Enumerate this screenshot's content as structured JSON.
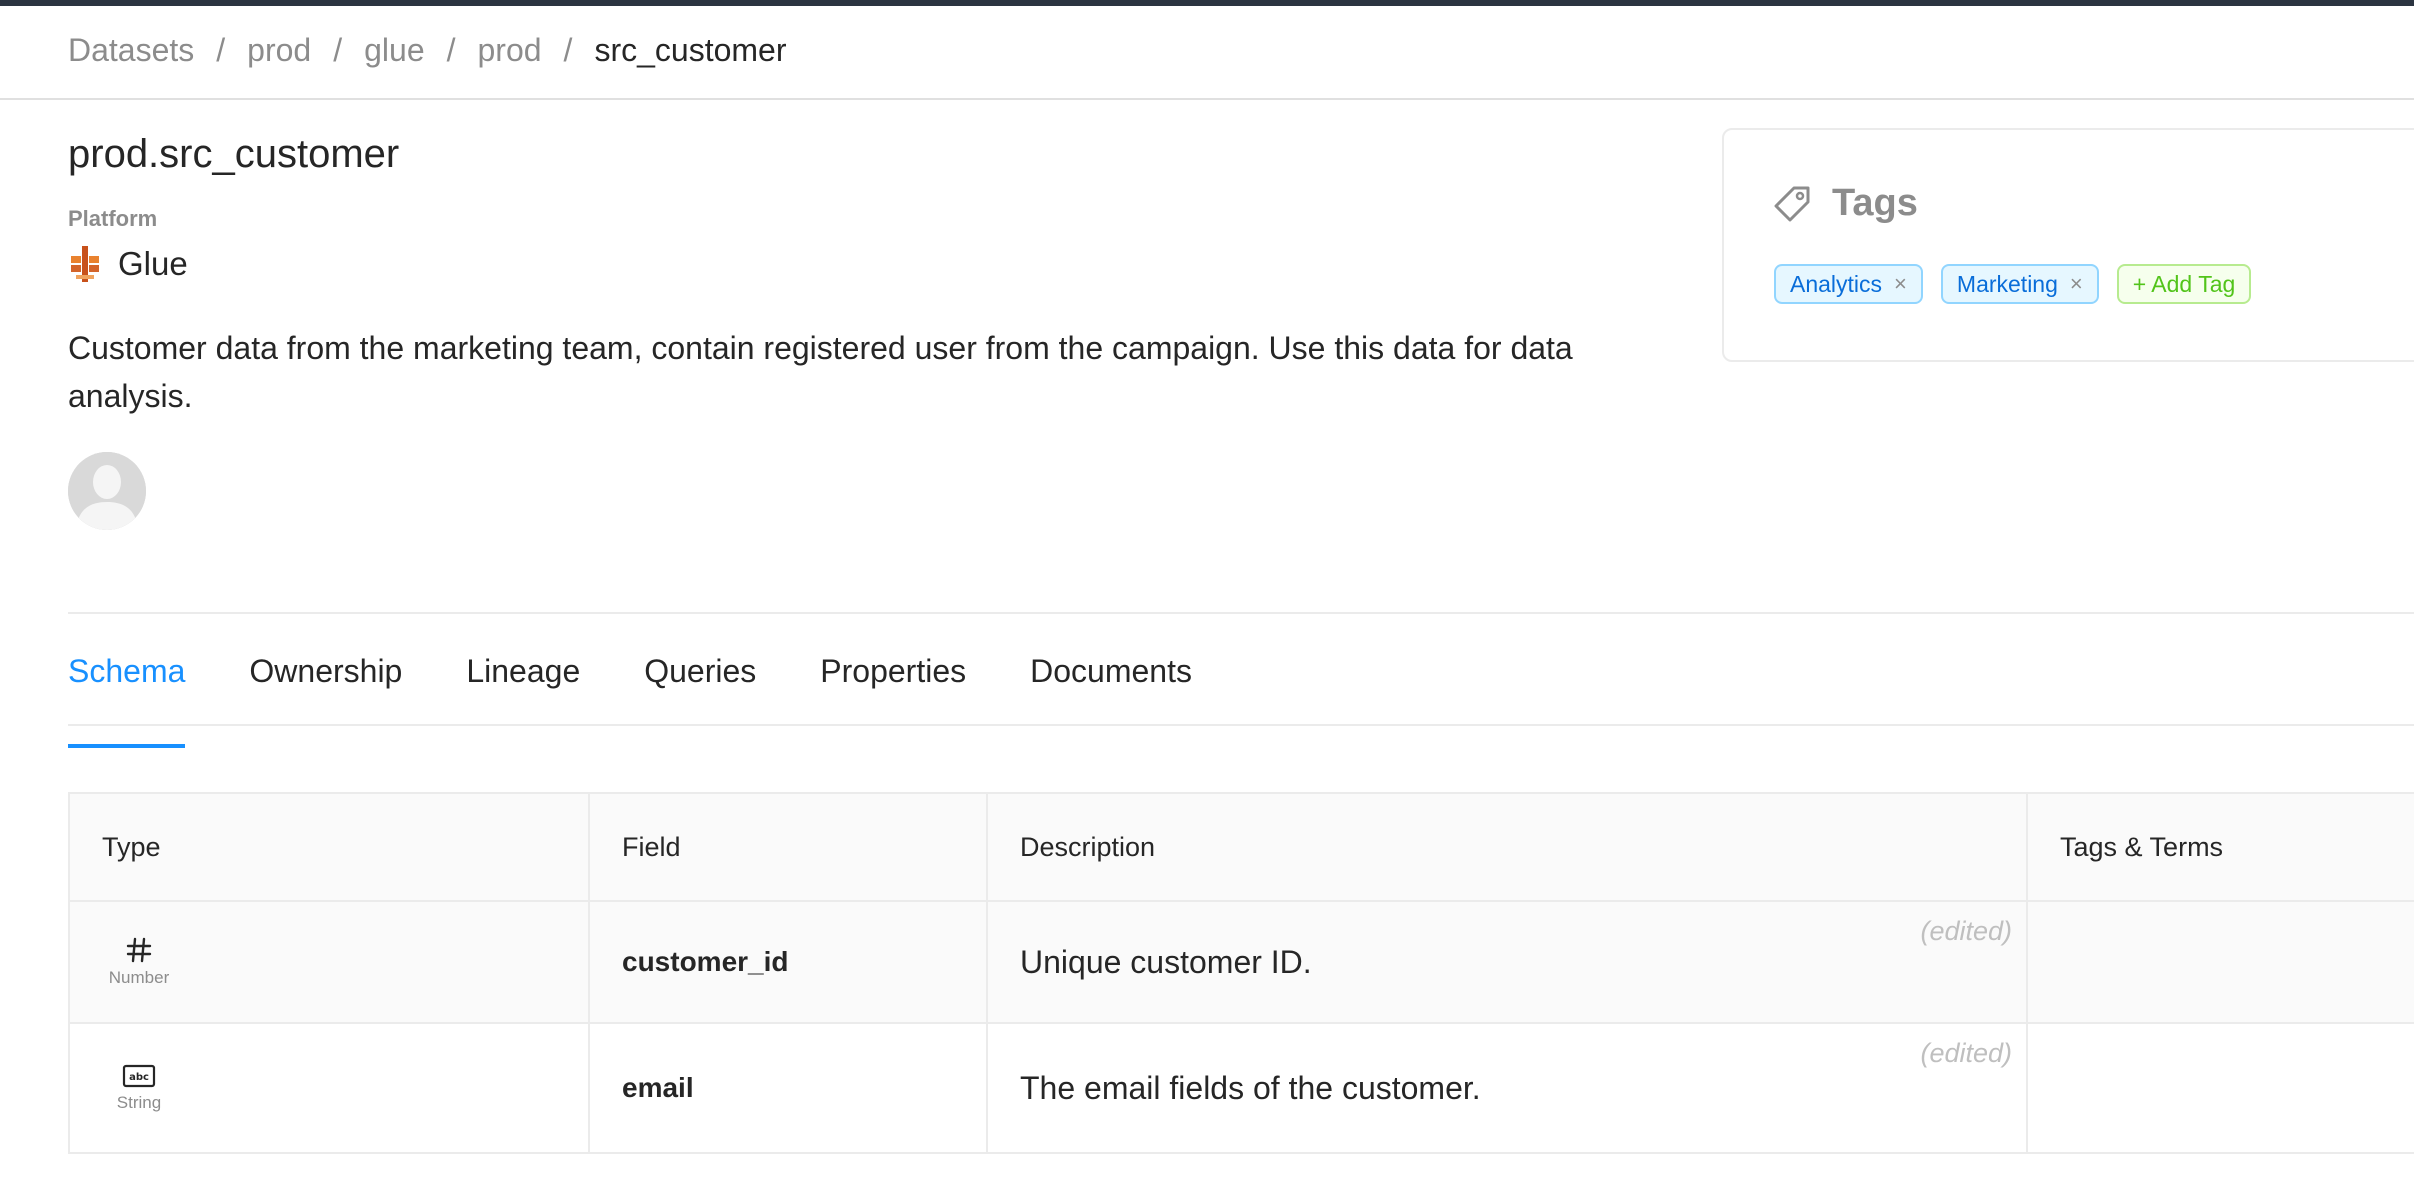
{
  "breadcrumb": {
    "items": [
      "Datasets",
      "prod",
      "glue",
      "prod"
    ],
    "separator": "/",
    "current": "src_customer"
  },
  "dataset": {
    "title": "prod.src_customer",
    "platform_label": "Platform",
    "platform_name": "Glue",
    "description": "Customer data from the marketing team, contain registered user from the campaign. Use this data for data analysis."
  },
  "tags_panel": {
    "title": "Tags",
    "tags": [
      "Analytics",
      "Marketing"
    ],
    "add_label": "+ Add Tag",
    "remove_glyph": "×"
  },
  "tabs": [
    "Schema",
    "Ownership",
    "Lineage",
    "Queries",
    "Properties",
    "Documents"
  ],
  "active_tab": "Schema",
  "schema": {
    "columns": [
      "Type",
      "Field",
      "Description",
      "Tags & Terms"
    ],
    "rows": [
      {
        "type_icon": "hash-icon",
        "type_glyph": "#",
        "type_label": "Number",
        "field": "customer_id",
        "description": "Unique customer ID.",
        "edited": "(edited)"
      },
      {
        "type_icon": "abc-string-icon",
        "type_glyph": "abc",
        "type_label": "String",
        "field": "email",
        "description": "The email fields of the customer.",
        "edited": "(edited)"
      }
    ]
  },
  "colors": {
    "accent": "#1890ff",
    "topbar": "#2b3441",
    "tag_blue_text": "#096dd9",
    "tag_green_text": "#52c41a"
  }
}
